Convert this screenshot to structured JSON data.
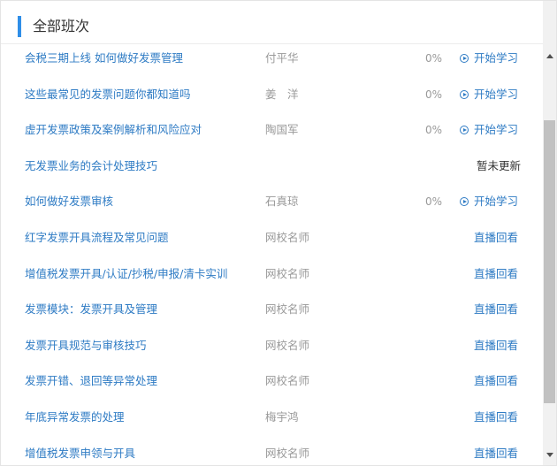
{
  "header": {
    "title": "全部班次"
  },
  "courses": [
    {
      "title": "会税三期上线 如何做好发票管理",
      "teacher": "付平华",
      "progress": "0%",
      "action": "开始学习",
      "action_type": "start"
    },
    {
      "title": "这些最常见的发票问题你都知道吗",
      "teacher": "姜　洋",
      "progress": "0%",
      "action": "开始学习",
      "action_type": "start"
    },
    {
      "title": "虚开发票政策及案例解析和风险应对",
      "teacher": "陶国军",
      "progress": "0%",
      "action": "开始学习",
      "action_type": "start"
    },
    {
      "title": "无发票业务的会计处理技巧",
      "teacher": "",
      "progress": "",
      "action": "暂未更新",
      "action_type": "none"
    },
    {
      "title": "如何做好发票审核",
      "teacher": "石真琼",
      "progress": "0%",
      "action": "开始学习",
      "action_type": "start"
    },
    {
      "title": "红字发票开具流程及常见问题",
      "teacher": "网校名师",
      "progress": "",
      "action": "直播回看",
      "action_type": "replay"
    },
    {
      "title": "增值税发票开具/认证/抄税/申报/清卡实训",
      "teacher": "网校名师",
      "progress": "",
      "action": "直播回看",
      "action_type": "replay"
    },
    {
      "title": "发票模块：发票开具及管理",
      "teacher": "网校名师",
      "progress": "",
      "action": "直播回看",
      "action_type": "replay"
    },
    {
      "title": "发票开具规范与审核技巧",
      "teacher": "网校名师",
      "progress": "",
      "action": "直播回看",
      "action_type": "replay"
    },
    {
      "title": "发票开错、退回等异常处理",
      "teacher": "网校名师",
      "progress": "",
      "action": "直播回看",
      "action_type": "replay"
    },
    {
      "title": "年底异常发票的处理",
      "teacher": "梅宇鸿",
      "progress": "",
      "action": "直播回看",
      "action_type": "replay"
    },
    {
      "title": "增值税发票申领与开具",
      "teacher": "网校名师",
      "progress": "",
      "action": "直播回看",
      "action_type": "replay"
    }
  ],
  "colors": {
    "accent": "#2f8ee8",
    "link": "#2e7bc4",
    "muted": "#999999"
  }
}
